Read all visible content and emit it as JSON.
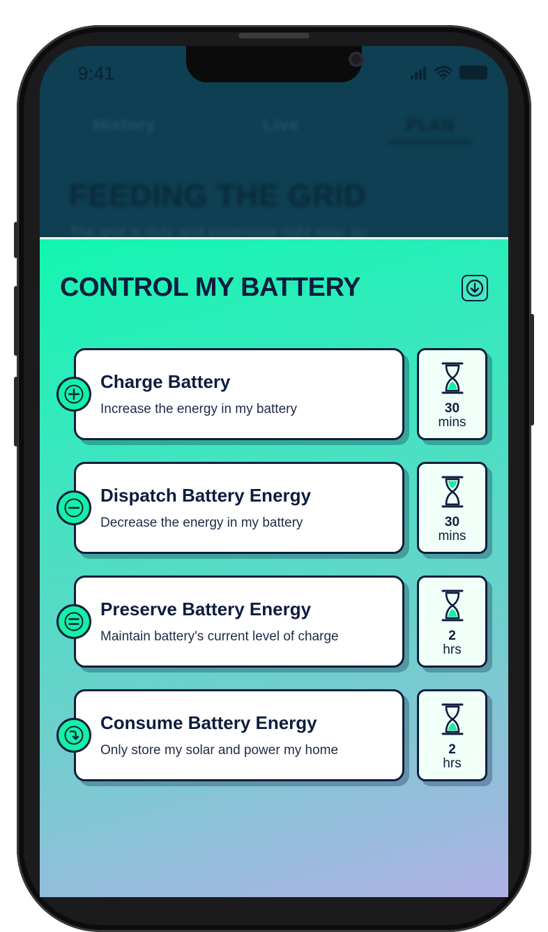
{
  "status_bar": {
    "time": "9:41"
  },
  "tabs": [
    {
      "label": "History"
    },
    {
      "label": "Live"
    },
    {
      "label": "PLAN"
    }
  ],
  "background_page": {
    "title": "FEEDING THE GRID",
    "subtitle": "The grid is dirty and expensive right now, so"
  },
  "sheet": {
    "title": "CONTROL MY BATTERY",
    "collapse_icon": "arrow-down-icon"
  },
  "actions": [
    {
      "title": "Charge Battery",
      "description": "Increase the energy in my battery",
      "icon": "plus-icon",
      "timer_value": "30",
      "timer_unit": "mins"
    },
    {
      "title": "Dispatch Battery Energy",
      "description": "Decrease the energy in my battery",
      "icon": "minus-icon",
      "timer_value": "30",
      "timer_unit": "mins"
    },
    {
      "title": "Preserve Battery Energy",
      "description": "Maintain battery's current level of charge",
      "icon": "equals-icon",
      "timer_value": "2",
      "timer_unit": "hrs"
    },
    {
      "title": "Consume Battery Energy",
      "description": "Only store my solar and power my home",
      "icon": "turn-down-arrow-icon",
      "timer_value": "2",
      "timer_unit": "hrs"
    }
  ],
  "colors": {
    "accent": "#14f0a6",
    "ink": "#0e1d3d",
    "header_bg": "#0e3f52"
  }
}
